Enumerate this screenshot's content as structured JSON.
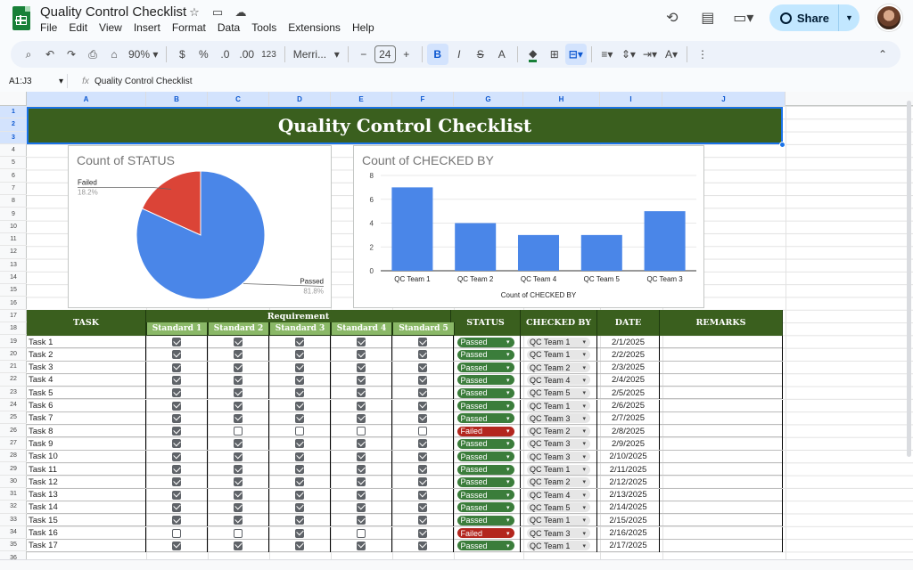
{
  "app": {
    "title": "Quality Control Checklist",
    "menu": [
      "File",
      "Edit",
      "View",
      "Insert",
      "Format",
      "Data",
      "Tools",
      "Extensions",
      "Help"
    ],
    "share_label": "Share"
  },
  "toolbar": {
    "zoom": "90%",
    "currency": "$",
    "percent": "%",
    "dec_decrease": ".0",
    "dec_increase": ".00",
    "number_format": "123",
    "font": "Merri...",
    "font_size": "24",
    "bold": "B"
  },
  "formula": {
    "cell_ref": "A1:J3",
    "content": "Quality Control Checklist"
  },
  "sheet": {
    "columns": [
      "A",
      "B",
      "C",
      "D",
      "E",
      "F",
      "G",
      "H",
      "I",
      "J"
    ],
    "rows": [
      "1",
      "2",
      "3",
      "4",
      "5",
      "6",
      "7",
      "8",
      "9",
      "10",
      "11",
      "12",
      "13",
      "14",
      "15",
      "16",
      "17",
      "18",
      "19",
      "20",
      "21",
      "22",
      "23",
      "24",
      "25",
      "26",
      "27",
      "28",
      "29",
      "30",
      "31",
      "32",
      "33",
      "34",
      "35",
      "36"
    ],
    "banner": "Quality Control Checklist"
  },
  "charts": {
    "pie_title": "Count of STATUS",
    "bar_title": "Count of CHECKED BY",
    "bar_xlabel": "Count of CHECKED BY"
  },
  "chart_data": [
    {
      "type": "pie",
      "title": "Count of STATUS",
      "categories": [
        "Failed",
        "Passed"
      ],
      "values": [
        18.2,
        81.8
      ],
      "labels": [
        "18.2%",
        "81.8%"
      ],
      "colors": [
        "#db4437",
        "#4a86e8"
      ]
    },
    {
      "type": "bar",
      "title": "Count of CHECKED BY",
      "xlabel": "Count of CHECKED BY",
      "categories": [
        "QC Team 1",
        "QC Team 2",
        "QC Team 4",
        "QC Team 5",
        "QC Team 3"
      ],
      "values": [
        7,
        4,
        3,
        3,
        5
      ],
      "ylim": [
        0,
        8
      ],
      "yticks": [
        0,
        2,
        4,
        6,
        8
      ],
      "color": "#4a86e8",
      "grid": true
    }
  ],
  "table": {
    "headers": {
      "task": "TASK",
      "requirement": "Requirement",
      "standards": [
        "Standard 1",
        "Standard 2",
        "Standard 3",
        "Standard 4",
        "Standard 5"
      ],
      "status": "STATUS",
      "checked_by": "CHECKED BY",
      "date": "DATE",
      "remarks": "REMARKS"
    },
    "rows": [
      {
        "task": "Task 1",
        "checks": [
          true,
          true,
          true,
          true,
          true
        ],
        "status": "Passed",
        "team": "QC Team 1",
        "date": "2/1/2025"
      },
      {
        "task": "Task 2",
        "checks": [
          true,
          true,
          true,
          true,
          true
        ],
        "status": "Passed",
        "team": "QC Team 1",
        "date": "2/2/2025"
      },
      {
        "task": "Task 3",
        "checks": [
          true,
          true,
          true,
          true,
          true
        ],
        "status": "Passed",
        "team": "QC Team 2",
        "date": "2/3/2025"
      },
      {
        "task": "Task 4",
        "checks": [
          true,
          true,
          true,
          true,
          true
        ],
        "status": "Passed",
        "team": "QC Team 4",
        "date": "2/4/2025"
      },
      {
        "task": "Task 5",
        "checks": [
          true,
          true,
          true,
          true,
          true
        ],
        "status": "Passed",
        "team": "QC Team 5",
        "date": "2/5/2025"
      },
      {
        "task": "Task 6",
        "checks": [
          true,
          true,
          true,
          true,
          true
        ],
        "status": "Passed",
        "team": "QC Team 1",
        "date": "2/6/2025"
      },
      {
        "task": "Task 7",
        "checks": [
          true,
          true,
          true,
          true,
          true
        ],
        "status": "Passed",
        "team": "QC Team 3",
        "date": "2/7/2025"
      },
      {
        "task": "Task 8",
        "checks": [
          true,
          false,
          false,
          false,
          false
        ],
        "status": "Failed",
        "team": "QC Team 2",
        "date": "2/8/2025"
      },
      {
        "task": "Task 9",
        "checks": [
          true,
          true,
          true,
          true,
          true
        ],
        "status": "Passed",
        "team": "QC Team 3",
        "date": "2/9/2025"
      },
      {
        "task": "Task 10",
        "checks": [
          true,
          true,
          true,
          true,
          true
        ],
        "status": "Passed",
        "team": "QC Team 3",
        "date": "2/10/2025"
      },
      {
        "task": "Task 11",
        "checks": [
          true,
          true,
          true,
          true,
          true
        ],
        "status": "Passed",
        "team": "QC Team 1",
        "date": "2/11/2025"
      },
      {
        "task": "Task 12",
        "checks": [
          true,
          true,
          true,
          true,
          true
        ],
        "status": "Passed",
        "team": "QC Team 2",
        "date": "2/12/2025"
      },
      {
        "task": "Task 13",
        "checks": [
          true,
          true,
          true,
          true,
          true
        ],
        "status": "Passed",
        "team": "QC Team 4",
        "date": "2/13/2025"
      },
      {
        "task": "Task 14",
        "checks": [
          true,
          true,
          true,
          true,
          true
        ],
        "status": "Passed",
        "team": "QC Team 5",
        "date": "2/14/2025"
      },
      {
        "task": "Task 15",
        "checks": [
          true,
          true,
          true,
          true,
          true
        ],
        "status": "Passed",
        "team": "QC Team 1",
        "date": "2/15/2025"
      },
      {
        "task": "Task 16",
        "checks": [
          false,
          false,
          true,
          false,
          true
        ],
        "status": "Failed",
        "team": "QC Team 3",
        "date": "2/16/2025"
      },
      {
        "task": "Task 17",
        "checks": [
          true,
          true,
          true,
          true,
          true
        ],
        "status": "Passed",
        "team": "QC Team 1",
        "date": "2/17/2025"
      }
    ]
  }
}
